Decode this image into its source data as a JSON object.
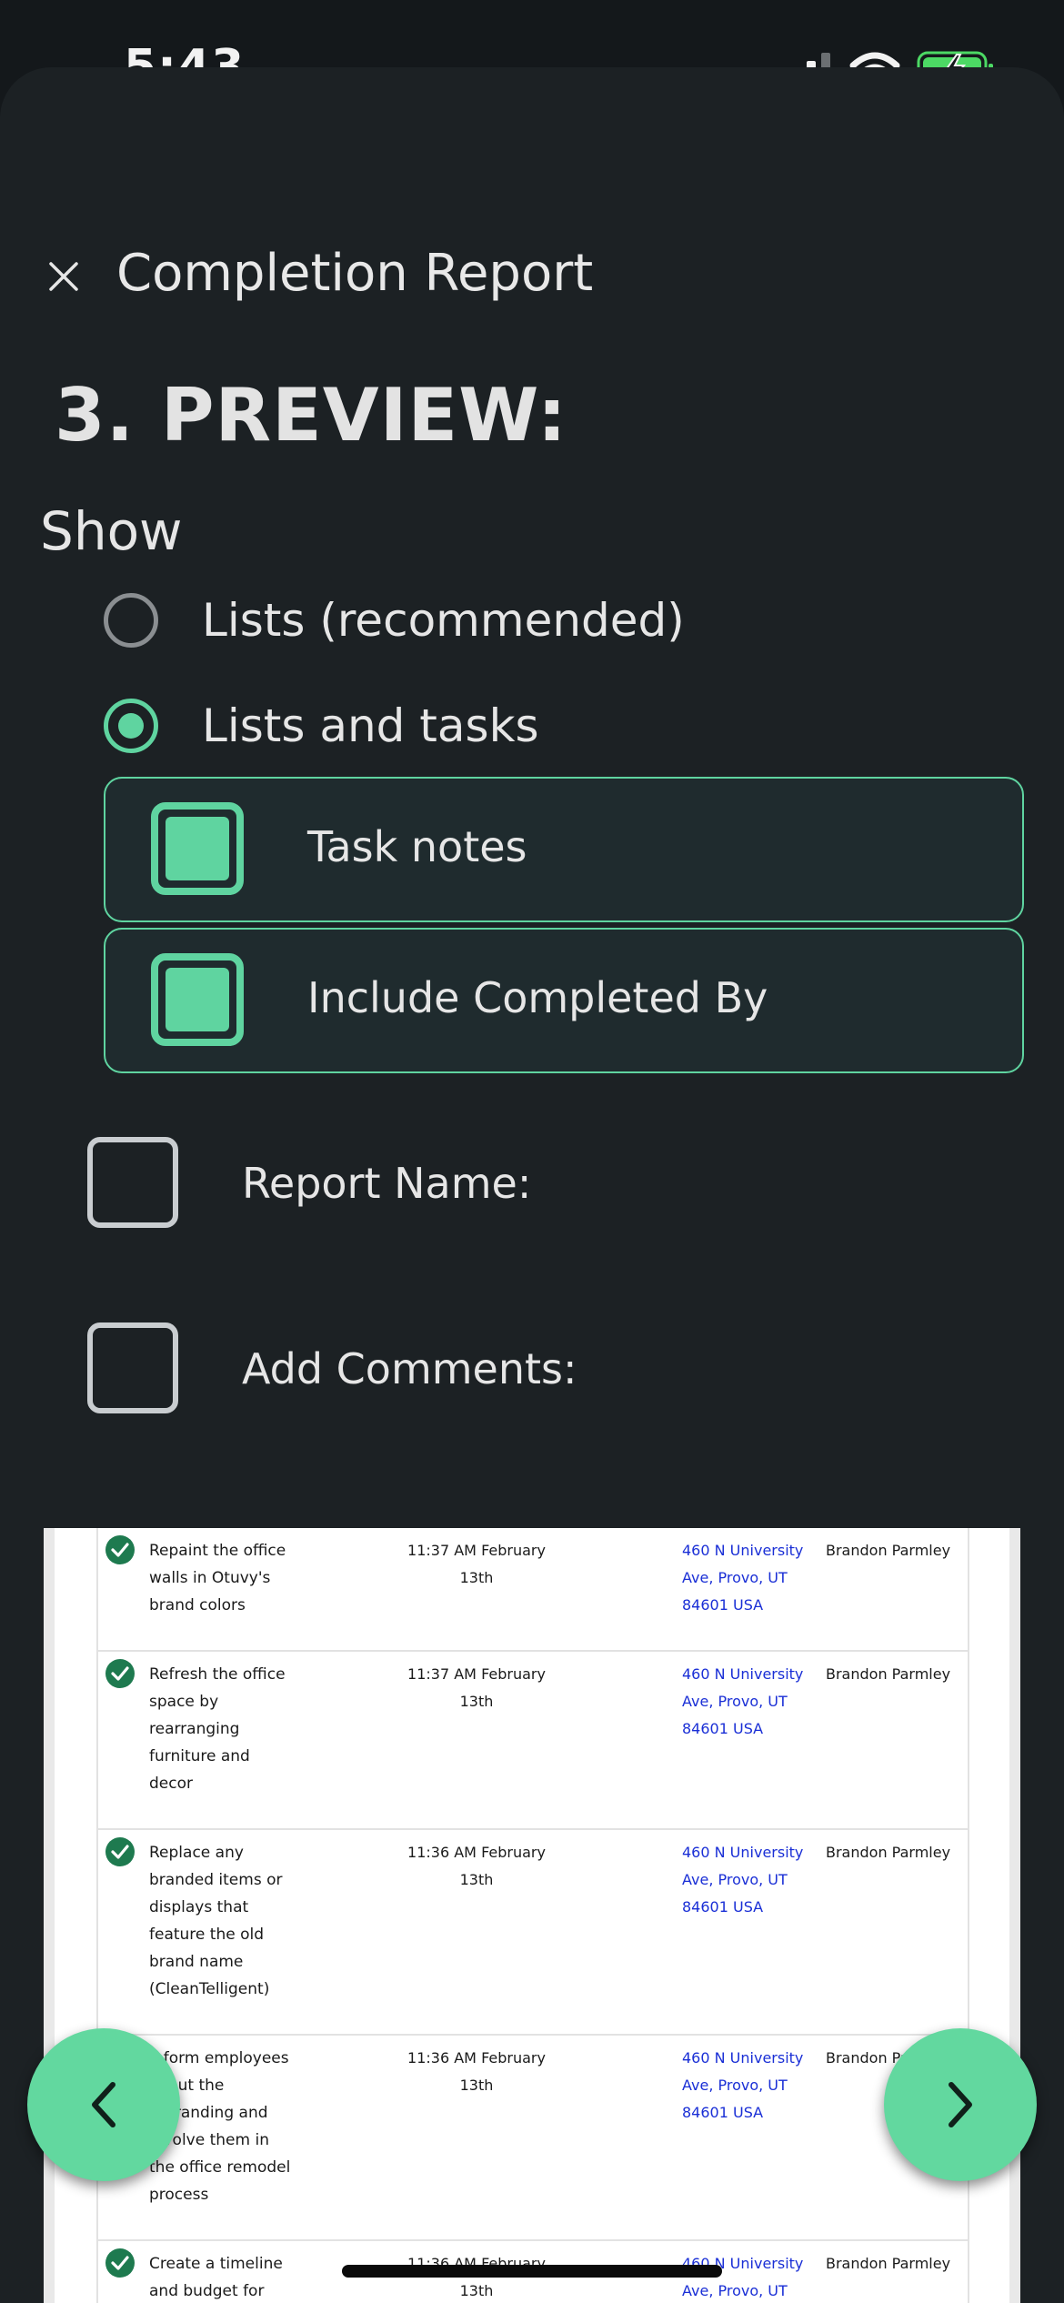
{
  "status_bar": {
    "time": "5:43"
  },
  "header": {
    "title": "Completion Report"
  },
  "step": {
    "title": "3. PREVIEW:"
  },
  "show": {
    "label": "Show",
    "options": [
      {
        "label": "Lists (recommended)",
        "selected": false
      },
      {
        "label": "Lists and tasks",
        "selected": true
      }
    ],
    "sub_options": [
      {
        "label": "Task notes",
        "checked": true
      },
      {
        "label": "Include Completed By",
        "checked": true
      }
    ]
  },
  "extras": [
    {
      "label": "Report Name:",
      "checked": false
    },
    {
      "label": "Add Comments:",
      "checked": false
    }
  ],
  "preview": {
    "rows": [
      {
        "task": "Repaint the office walls in Otuvy's brand colors",
        "time": "11:37 AM February 13th",
        "address": "460 N University Ave, Provo, UT 84601 USA",
        "user": "Brandon Parmley"
      },
      {
        "task": "Refresh the office space by rearranging furniture and decor",
        "time": "11:37 AM February 13th",
        "address": "460 N University Ave, Provo, UT 84601 USA",
        "user": "Brandon Parmley"
      },
      {
        "task": "Replace any branded items or displays that feature the old brand name (CleanTelligent)",
        "time": "11:36 AM February 13th",
        "address": "460 N University Ave, Provo, UT 84601 USA",
        "user": "Brandon Parmley"
      },
      {
        "task": "Inform employees about the rebranding and involve them in the office remodel process",
        "time": "11:36 AM February 13th",
        "address": "460 N University Ave, Provo, UT 84601 USA",
        "user": "Brandon Parmley"
      },
      {
        "task": "Create a timeline and budget for",
        "time": "11:36 AM February 13th",
        "address": "460 N University Ave, Provo, UT",
        "user": "Brandon Parmley"
      }
    ]
  },
  "colors": {
    "accent": "#5fd4a0",
    "background": "#1c2124",
    "link": "#1a2fd6"
  }
}
